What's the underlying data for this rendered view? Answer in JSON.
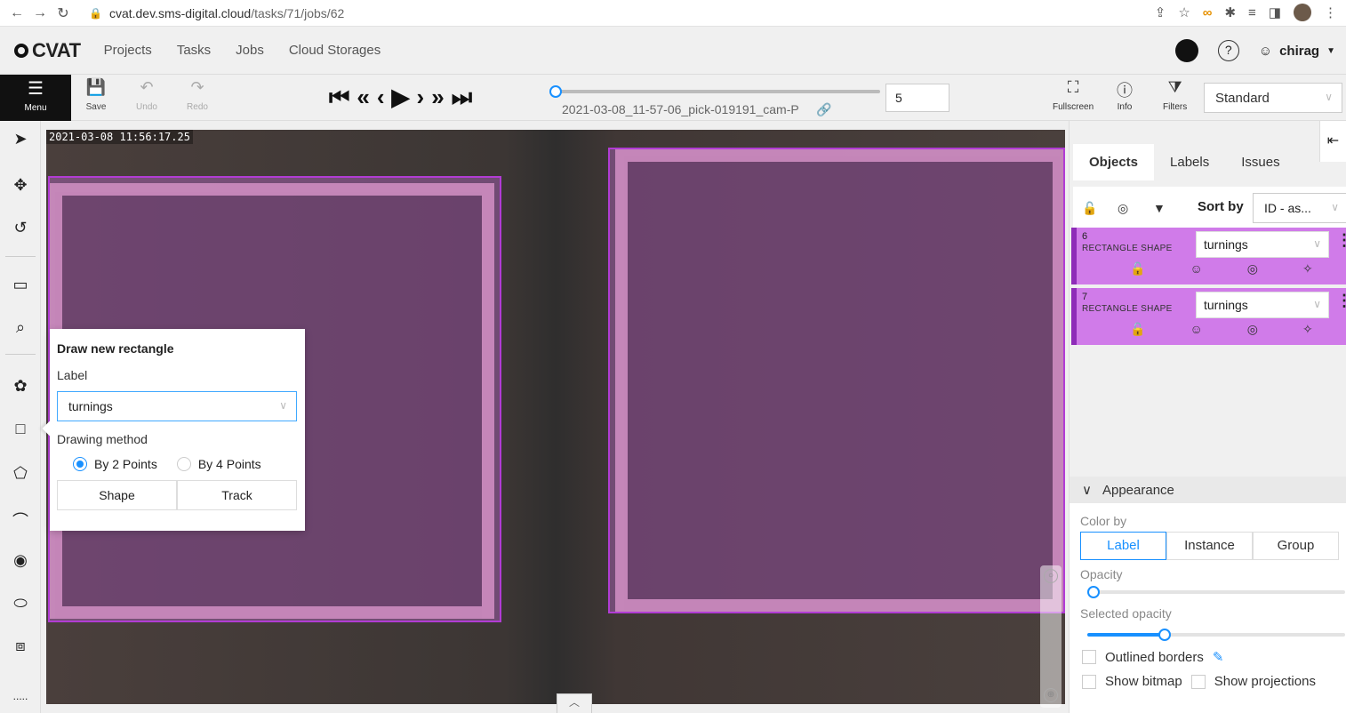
{
  "browser": {
    "url_host": "cvat.dev.sms-digital.cloud",
    "url_path": "/tasks/71/jobs/62"
  },
  "header": {
    "logo": "CVAT",
    "nav": [
      "Projects",
      "Tasks",
      "Jobs",
      "Cloud Storages"
    ],
    "user": "chirag"
  },
  "toolbar": {
    "menu": "Menu",
    "save": "Save",
    "undo": "Undo",
    "redo": "Redo",
    "filename": "2021-03-08_11-57-06_pick-019191_cam-P",
    "frame": "5",
    "fullscreen": "Fullscreen",
    "info": "Info",
    "filters": "Filters",
    "workspace": "Standard"
  },
  "canvas": {
    "timestamp": "2021-03-08 11:56:17.25"
  },
  "draw_popover": {
    "title": "Draw new rectangle",
    "label_caption": "Label",
    "label_value": "turnings",
    "method_caption": "Drawing method",
    "method_options": [
      "By 2 Points",
      "By 4 Points"
    ],
    "selected_method": "By 2 Points",
    "shape_button": "Shape",
    "track_button": "Track"
  },
  "right_panel": {
    "tabs": [
      "Objects",
      "Labels",
      "Issues"
    ],
    "active_tab": "Objects",
    "sort_by_label": "Sort by",
    "sort_value": "ID - as...",
    "objects": [
      {
        "id": "6",
        "type": "RECTANGLE SHAPE",
        "label": "turnings"
      },
      {
        "id": "7",
        "type": "RECTANGLE SHAPE",
        "label": "turnings"
      }
    ],
    "appearance": {
      "title": "Appearance",
      "color_by_caption": "Color by",
      "color_by_options": [
        "Label",
        "Instance",
        "Group"
      ],
      "color_by_selected": "Label",
      "opacity_caption": "Opacity",
      "opacity": 0,
      "selected_opacity_caption": "Selected opacity",
      "selected_opacity": 0.3,
      "outlined_borders": "Outlined borders",
      "show_bitmap": "Show bitmap",
      "show_projections": "Show projections"
    }
  },
  "colors": {
    "accent": "#1890ff",
    "object_fill": "#d07be9",
    "object_border": "#8e2cb8"
  }
}
